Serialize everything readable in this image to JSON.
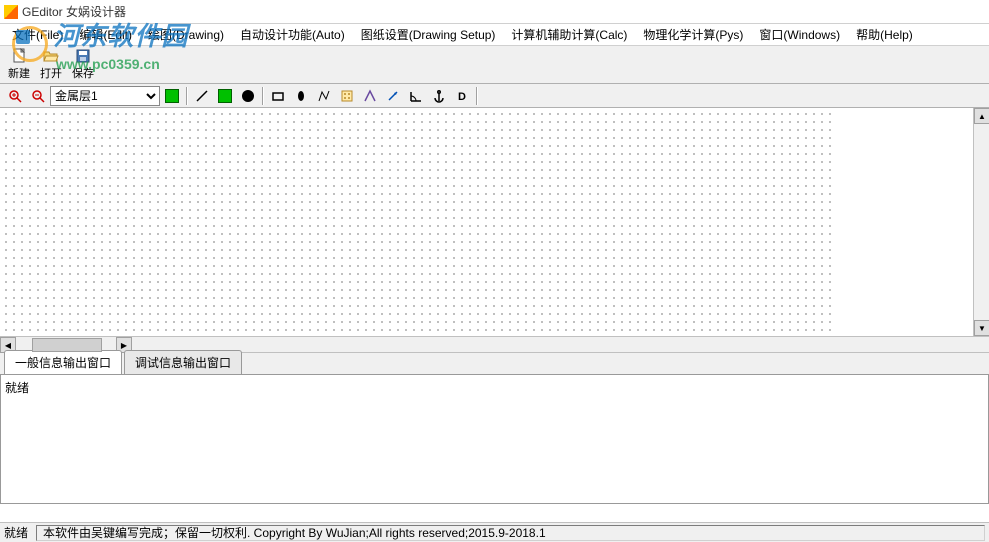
{
  "title": "GEditor 女娲设计器",
  "menu": {
    "file": "文件(File)",
    "edit": "编辑(Edit)",
    "drawing": "绘图(Drawing)",
    "auto": "自动设计功能(Auto)",
    "setup": "图纸设置(Drawing Setup)",
    "calc": "计算机辅助计算(Calc)",
    "pys": "物理化学计算(Pys)",
    "windows": "窗口(Windows)",
    "help": "帮助(Help)"
  },
  "toolbar": {
    "new": "新建",
    "open": "打开",
    "save": "保存"
  },
  "layer": {
    "selected": "金属层1"
  },
  "tabs": {
    "general": "一般信息输出窗口",
    "debug": "调试信息输出窗口"
  },
  "output": {
    "text": "就绪"
  },
  "status": {
    "ready": "就绪",
    "copyright": "本软件由吴键编写完成；保留一切权利. Copyright By WuJian;All rights reserved;2015.9-2018.1"
  },
  "watermark": {
    "text": "河东软件园",
    "url": "www.pc0359.cn"
  }
}
